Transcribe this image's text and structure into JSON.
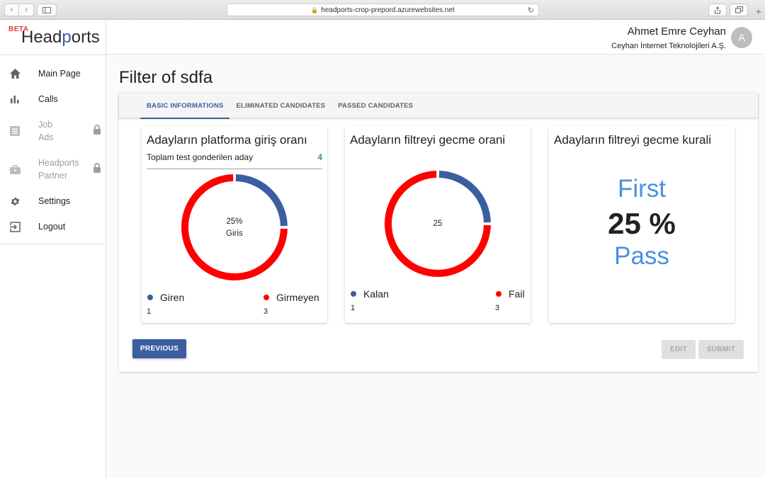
{
  "browser": {
    "url": "headports-crop-prepord.azurewebsites.net",
    "lock_icon": "lock-icon",
    "reload_icon": "reload-icon"
  },
  "brand": {
    "beta": "BETA",
    "name_pre": "Head",
    "name_p": "p",
    "name_post": "orts"
  },
  "sidebar": {
    "items": [
      {
        "label": "Main Page",
        "icon": "home-icon"
      },
      {
        "label": "Calls",
        "icon": "bar-chart-icon"
      },
      {
        "label": "Job\nAds",
        "icon": "list-icon",
        "locked": true
      },
      {
        "label": "Headports\nPartner",
        "icon": "briefcase-icon",
        "locked": true
      },
      {
        "label": "Settings",
        "icon": "gear-icon"
      },
      {
        "label": "Logout",
        "icon": "logout-icon"
      }
    ]
  },
  "header": {
    "user_name": "Ahmet Emre Ceyhan",
    "company": "Ceyhan İnternet Teknolojileri A.Ş.",
    "avatar_initial": "A"
  },
  "page": {
    "title": "Filter of sdfa"
  },
  "tabs": [
    "BASIC INFORMATIONS",
    "ELIMINATED CANDIDATES",
    "PASSED CANDIDATES"
  ],
  "active_tab": 0,
  "cards": {
    "entry": {
      "title": "Adayların platforma giriş oranı",
      "total_label": "Toplam test gonderilen aday",
      "total_value": "4",
      "center_pct": "25%",
      "center_label": "Giris",
      "fraction": 0.25,
      "legend": [
        {
          "label": "Giren",
          "value": "1",
          "color": "#3b5ea0"
        },
        {
          "label": "Girmeyen",
          "value": "3",
          "color": "#ff0000"
        }
      ]
    },
    "filter": {
      "title": "Adayların filtreyi gecme orani",
      "center_value": "25",
      "fraction": 0.25,
      "legend": [
        {
          "label": "Kalan",
          "value": "1",
          "color": "#3b5ea0"
        },
        {
          "label": "Fail",
          "value": "3",
          "color": "#ff0000"
        }
      ]
    },
    "rule": {
      "title": "Adayların filtreyi gecme kurali",
      "first": "First",
      "percent": "25 %",
      "pass": "Pass"
    }
  },
  "buttons": {
    "previous": "PREVIOUS",
    "edit": "EDIT",
    "submit": "SUBMIT"
  },
  "colors": {
    "accent": "#3b5ea0",
    "fail": "#ff0000",
    "success": "#43a047",
    "rule_text": "#4a8fe0"
  }
}
